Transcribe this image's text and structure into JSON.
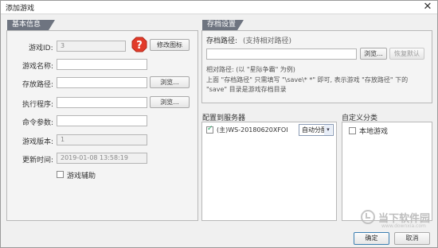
{
  "window": {
    "title": "添加游戏",
    "close_glyph": "✕"
  },
  "basic": {
    "tab": "基本信息",
    "fields": {
      "game_id_label": "游戏ID:",
      "game_id_value": "3",
      "modify_icon_button": "修改图标",
      "name_label": "游戏名称:",
      "name_value": "",
      "save_path_label": "存放路径:",
      "save_path_value": "",
      "browse_1": "浏览...",
      "exec_label": "执行程序:",
      "exec_value": "",
      "browse_2": "浏览...",
      "cmd_label": "命令参数:",
      "cmd_value": "",
      "version_label": "游戏版本:",
      "version_value": "1",
      "updated_label": "更新时间:",
      "updated_value": "2019-01-08 13:58:19",
      "assist_label": "游戏辅助"
    }
  },
  "archive": {
    "tab": "存档设置",
    "path_label": "存档路径:",
    "path_hint": "(支持相对路径)",
    "path_value": "",
    "browse": "浏览...",
    "restore": "恢复默认",
    "rel_line1": "相对路径: (以 \"星际争霸\" 为例)",
    "rel_line2": "上面 \"存档路径\" 只需填写 \"\\save\\* *\" 即可, 表示游戏 \"存放路径\" 下的",
    "rel_line3": "\"save\" 目录是游戏存档目录"
  },
  "servers": {
    "title": "配置到服务器",
    "items": [
      {
        "checked": true,
        "name": "(主)WS-20180620XFOI",
        "mode": "自动分配"
      }
    ]
  },
  "categories": {
    "title": "自定义分类",
    "items": [
      {
        "checked": false,
        "name": "本地游戏"
      }
    ]
  },
  "watermark": {
    "cn": "当下软件园",
    "en": "www.downxia.com"
  },
  "footer": {
    "ok": "确定",
    "cancel": "取消"
  }
}
